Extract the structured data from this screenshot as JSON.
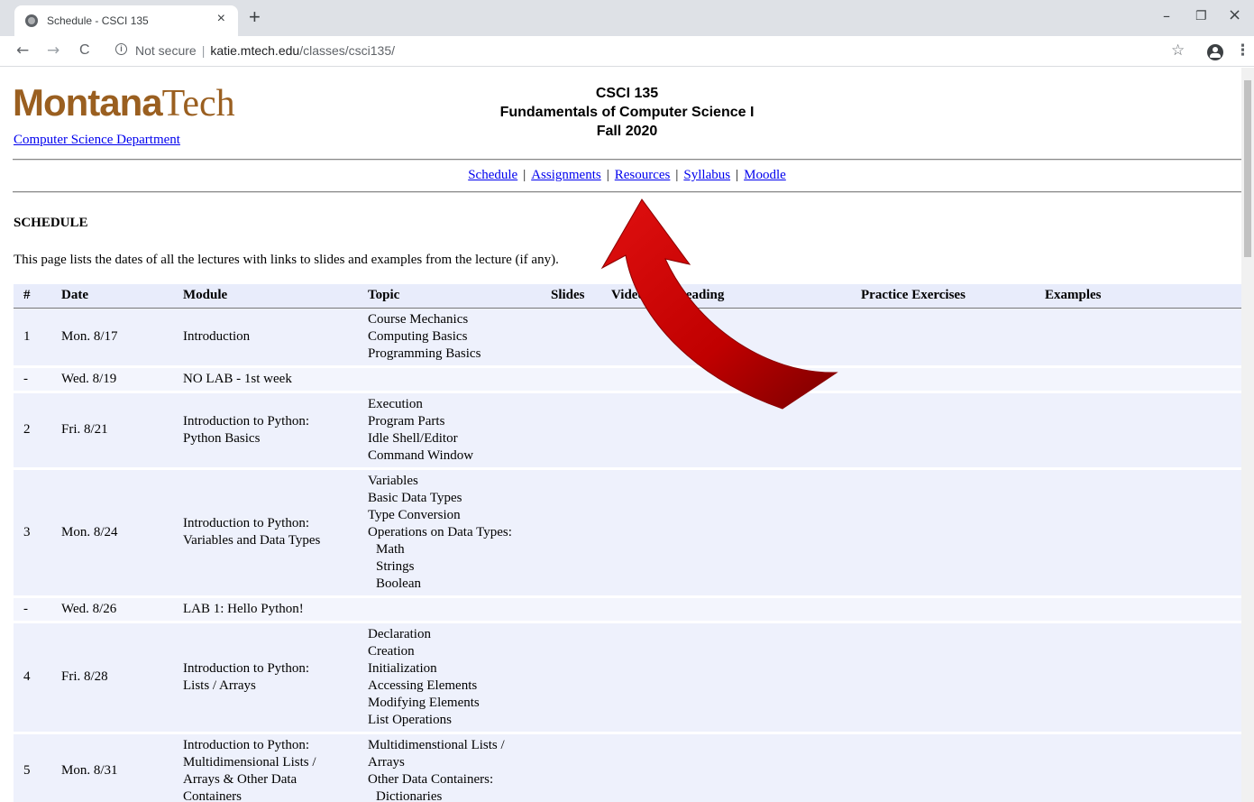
{
  "browser": {
    "tab_title": "Schedule - CSCI 135",
    "new_tab": "+",
    "close_tab": "×",
    "omnibox": {
      "security": "Not secure",
      "host": "katie.mtech.edu",
      "path": "/classes/csci135/"
    },
    "window_controls": {
      "minimize": "–",
      "restore": "❐",
      "close": "×"
    },
    "nav": {
      "back": "←",
      "forward": "→",
      "reload": "C"
    },
    "star": "☆",
    "menu": "⋮"
  },
  "header": {
    "logo_bold": "Montana",
    "logo_light": "Tech",
    "dept_link": "Computer Science Department",
    "course_code": "CSCI 135",
    "course_name": "Fundamentals of Computer Science I",
    "term": "Fall 2020"
  },
  "nav_links": [
    "Schedule",
    "Assignments",
    "Resources",
    "Syllabus",
    "Moodle"
  ],
  "nav_sep": "|",
  "section_title": "SCHEDULE",
  "intro": "This page lists the dates of all the lectures with links to slides and examples from the lecture (if any).",
  "table": {
    "headers": [
      "#",
      "Date",
      "Module",
      "Topic",
      "Slides",
      "Videos",
      "Reading",
      "Practice Exercises",
      "Examples"
    ],
    "rows": [
      {
        "num": "1",
        "date": "Mon. 8/17",
        "module": [
          "Introduction"
        ],
        "topic": [
          "Course Mechanics",
          "Computing Basics",
          "Programming Basics"
        ]
      },
      {
        "num": "-",
        "date": "Wed. 8/19",
        "module": [
          "NO LAB - 1st week"
        ],
        "topic": []
      },
      {
        "num": "2",
        "date": "Fri. 8/21",
        "module": [
          "Introduction to Python:",
          "Python Basics"
        ],
        "topic": [
          "Execution",
          "Program Parts",
          "Idle Shell/Editor",
          "Command Window"
        ]
      },
      {
        "num": "3",
        "date": "Mon. 8/24",
        "module": [
          "Introduction to Python:",
          "Variables and Data Types"
        ],
        "topic": [
          "Variables",
          "Basic Data Types",
          "Type Conversion",
          "Operations on Data Types:",
          ">Math",
          ">Strings",
          ">Boolean"
        ]
      },
      {
        "num": "-",
        "date": "Wed. 8/26",
        "module": [
          "LAB 1: Hello Python!"
        ],
        "topic": []
      },
      {
        "num": "4",
        "date": "Fri. 8/28",
        "module": [
          "Introduction to Python:",
          "Lists / Arrays"
        ],
        "topic": [
          "Declaration",
          "Creation",
          "Initialization",
          "Accessing Elements",
          "Modifying Elements",
          "List Operations"
        ]
      },
      {
        "num": "5",
        "date": "Mon. 8/31",
        "module": [
          "Introduction to Python:",
          "Multidimensional Lists /",
          "Arrays & Other Data",
          "Containers"
        ],
        "topic": [
          "Multidimenstional Lists /",
          "Arrays",
          "Other Data Containers:",
          ">Dictionaries"
        ]
      }
    ]
  },
  "annotation": {
    "arrow_color": "#c00000",
    "points_to": "Resources"
  }
}
